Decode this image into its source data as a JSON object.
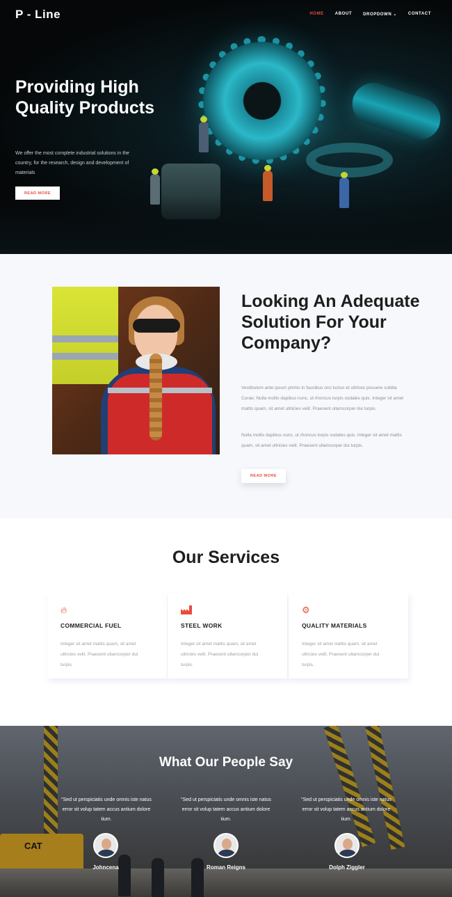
{
  "header": {
    "brand": "P - Line",
    "nav": [
      {
        "label": "HOME",
        "active": true
      },
      {
        "label": "ABOUT",
        "active": false
      },
      {
        "label": "DROPDOWN",
        "active": false
      },
      {
        "label": "CONTACT",
        "active": false
      }
    ]
  },
  "hero": {
    "title": "Providing High Quality Products",
    "subtitle": "We offer the most complete industrial solutions in the country, for the research, design and development of materials",
    "button_label": "READ MORE"
  },
  "about": {
    "title": "Looking An Adequate Solution For Your Company?",
    "paragraph1": "Vestibulum ante ipsum primis in faucibus orci luctus et ultrices posuere cubilia Curae; Nulla mollis dapibus nunc, ut rhoncus turpis sodales quis. Integer sit amet mattis quam, sit amet ultricies velit. Praesent ullamcorper dui turpis.",
    "paragraph2": "Nulla mollis dapibus nunc, ut rhoncus turpis sodales quis. Integer sit amet mattis quam, sit amet ultricies velit. Praesent ullamcorper dui turpis.",
    "button_label": "READ MORE"
  },
  "services": {
    "title": "Our Services",
    "items": [
      {
        "icon": "flame-icon",
        "title": "COMMERCIAL FUEL",
        "text": "Integer sit amet mattis quam, sit amet ultricies velit. Praesent ullamcorper dui turpis."
      },
      {
        "icon": "factory-icon",
        "title": "STEEL WORK",
        "text": "Integer sit amet mattis quam, sit amet ultricies velit. Praesent ullamcorper dui turpis."
      },
      {
        "icon": "gears-icon",
        "title": "QUALITY MATERIALS",
        "text": "Integer sit amet mattis quam, sit amet ultricies velit. Praesent ullamcorper dui turpis."
      }
    ]
  },
  "testimonials": {
    "title": "What Our People Say",
    "items": [
      {
        "quote": "Sed ut perspiciatis unde omnis iste natus error sit volup tatem accus antium dolore tium.",
        "name": "Johncena"
      },
      {
        "quote": "Sed ut perspiciatis unde omnis iste natus error sit volup tatem accus antium dolore tium.",
        "name": "Roman Reigns"
      },
      {
        "quote": "Sed ut perspiciatis unde omnis iste natus error sit volup tatem accus antium dolore tium.",
        "name": "Dolph Ziggler"
      }
    ],
    "bulldozer_text": "CAT"
  },
  "colors": {
    "accent": "#e74c3c",
    "dark_text": "#1e1e1e",
    "muted_text": "#8b9097"
  }
}
